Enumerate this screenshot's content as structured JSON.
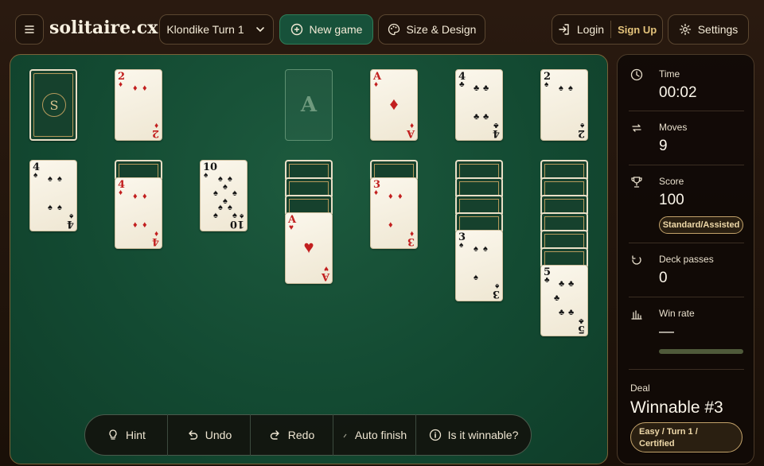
{
  "header": {
    "logo": "solitaire.cx",
    "variant_label": "Klondike Turn 1",
    "new_game_label": "New game",
    "design_label": "Size & Design",
    "login_label": "Login",
    "signup_label": "Sign Up",
    "settings_label": "Settings"
  },
  "board": {
    "stock_logo": "S",
    "foundation_placeholder": "A",
    "waste": [
      {
        "rank": "2",
        "suit": "♦",
        "color": "red"
      }
    ],
    "foundations": [
      {
        "rank": "A",
        "suit": "♦",
        "color": "red"
      },
      {
        "rank": "4",
        "suit": "♣",
        "color": "black"
      },
      {
        "rank": "2",
        "suit": "♠",
        "color": "black"
      }
    ],
    "tableau": [
      {
        "hidden": 0,
        "face": {
          "rank": "4",
          "suit": "♠",
          "color": "black"
        }
      },
      {
        "hidden": 1,
        "face": {
          "rank": "4",
          "suit": "♦",
          "color": "red"
        }
      },
      {
        "hidden": 0,
        "face": {
          "rank": "10",
          "suit": "♠",
          "color": "black"
        }
      },
      {
        "hidden": 3,
        "face": {
          "rank": "A",
          "suit": "♥",
          "color": "red"
        }
      },
      {
        "hidden": 1,
        "face": {
          "rank": "3",
          "suit": "♦",
          "color": "red"
        }
      },
      {
        "hidden": 4,
        "face": {
          "rank": "3",
          "suit": "♠",
          "color": "black"
        }
      },
      {
        "hidden": 6,
        "face": {
          "rank": "5",
          "suit": "♣",
          "color": "black"
        }
      }
    ]
  },
  "actions": {
    "hint": "Hint",
    "undo": "Undo",
    "redo": "Redo",
    "auto_finish": "Auto finish",
    "winnable": "Is it winnable?"
  },
  "stats": {
    "time_label": "Time",
    "time_value": "00:02",
    "moves_label": "Moves",
    "moves_value": "9",
    "score_label": "Score",
    "score_value": "100",
    "score_badge": "Standard/Assisted",
    "passes_label": "Deck passes",
    "passes_value": "0",
    "winrate_label": "Win rate",
    "winrate_value": "—",
    "deal_label": "Deal",
    "deal_value": "Winnable #3",
    "deal_badge_line1": "Easy / Turn 1 /",
    "deal_badge_line2": "Certified"
  },
  "colors": {
    "accent": "#17513a",
    "felt": "#134a32",
    "gold": "#c2a26a"
  }
}
